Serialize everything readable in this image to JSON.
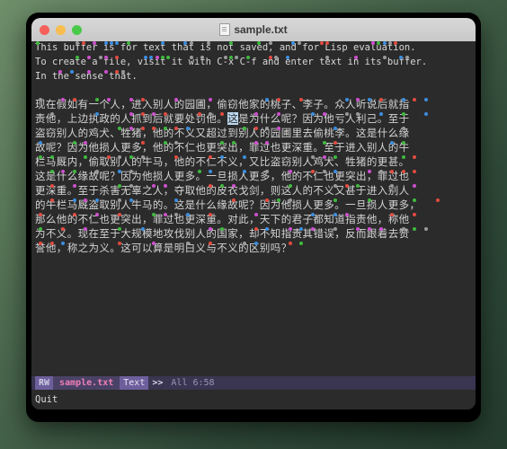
{
  "window": {
    "title": "sample.txt",
    "doc_icon": "document-icon",
    "controls": {
      "close": "close-button",
      "minimize": "minimize-button",
      "maximize": "maximize-button"
    }
  },
  "editor": {
    "english_lines": [
      "This buffer is for text that is not saved, and for Lisp evaluation.",
      "To create a file, visit it with C-x C-f and enter text in its buffer.",
      "In the sense that."
    ],
    "blank_line": "",
    "chinese_lines": [
      "现在假如有一个人，进入别人的园圃，偷窃他家的桃子、李子。众人听说后就指",
      "责他，上边执政的人抓到后就要处罚他。这是为什么呢？因为他亏人利己。至于",
      "盗窃别人的鸡犬、牲猪，他的不义又超过到别人的园圃里去偷桃李。这是什么缘",
      "故呢？因为他损人更多，他的不仁也更突出，罪过也更深重。至于进入别人的牛",
      "栏马厩内，偷取别人的牛马，他的不仁不义，又比盗窃别人鸡犬、牲猪的更甚。",
      "这是什么缘故呢？因为他损人更多。一旦损人更多，他的不仁也更突出，罪过也",
      "更深重。至于杀害无辜之人，夺取他的皮衣戈剑，则这人的不义又甚于进入别人",
      "的牛栏马厩盗取别人牛马的。这是什么缘故呢？因为他损人更多。一旦损人更多，",
      "那么他的不仁也更突出，罪过也更深重。对此，天下的君子都知道指责他，称他",
      "为不义。现在至于大规模地攻伐别人的国家，却不知指责其错误，反而跟着去赞",
      "誉他，称之为义。这可以算是明白义与不义的区别吗？"
    ]
  },
  "modeline": {
    "rw": "RW",
    "buffer_name": "sample.txt",
    "major_mode": "Text",
    "arrows": ">>",
    "position": "All 6:58"
  },
  "echo_area": {
    "message": "Quit"
  },
  "colors": {
    "terminal_bg": "#2b2b2b",
    "terminal_fg": "#d8d8d8",
    "modeline_bg": "#3a3550",
    "modeline_accent": "#6d5f9c",
    "buffer_name_fg": "#f07fb8",
    "dot_red": "#e34b3f",
    "dot_blue": "#3b8ee0",
    "dot_gray": "#9a9a9a",
    "dot_green": "#3fb93f",
    "dot_magenta": "#cf4fcf",
    "cursor_bg": "#bcd8ef"
  }
}
